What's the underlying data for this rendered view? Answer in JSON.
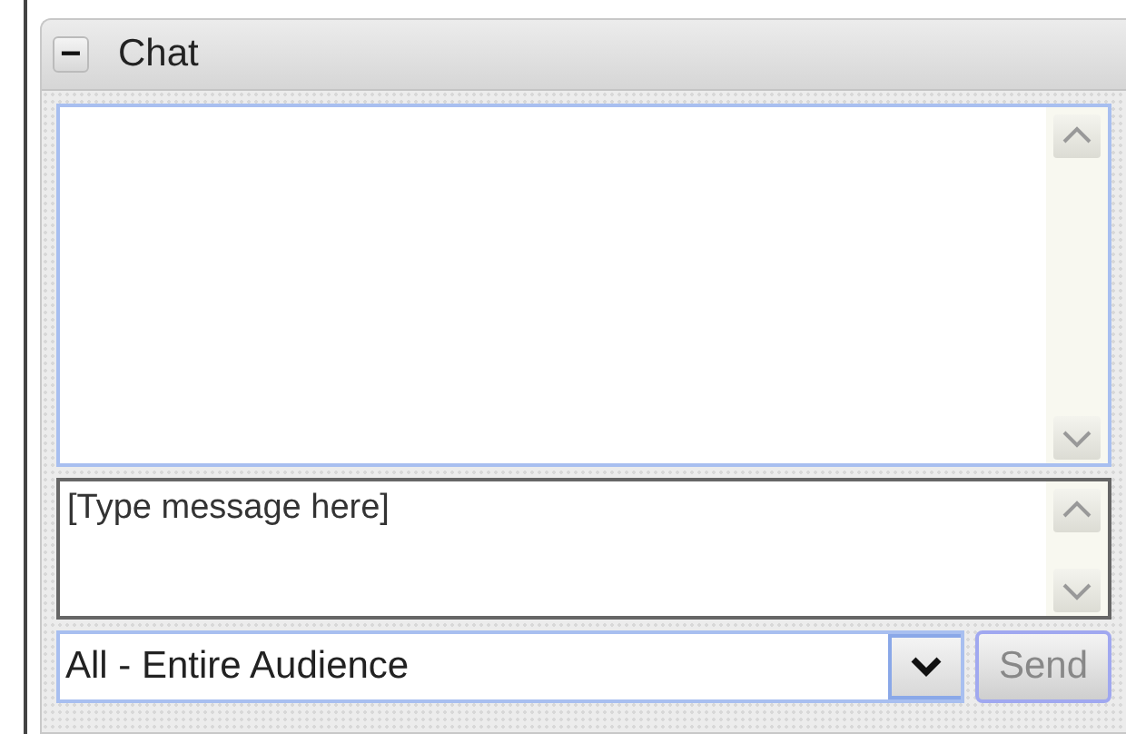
{
  "panel": {
    "title": "Chat",
    "collapse_symbol": "−",
    "expanded": true
  },
  "message_input": {
    "placeholder": "[Type message here]"
  },
  "recipient_select": {
    "value": "All - Entire Audience"
  },
  "send_button": {
    "label": "Send",
    "disabled": true
  }
}
